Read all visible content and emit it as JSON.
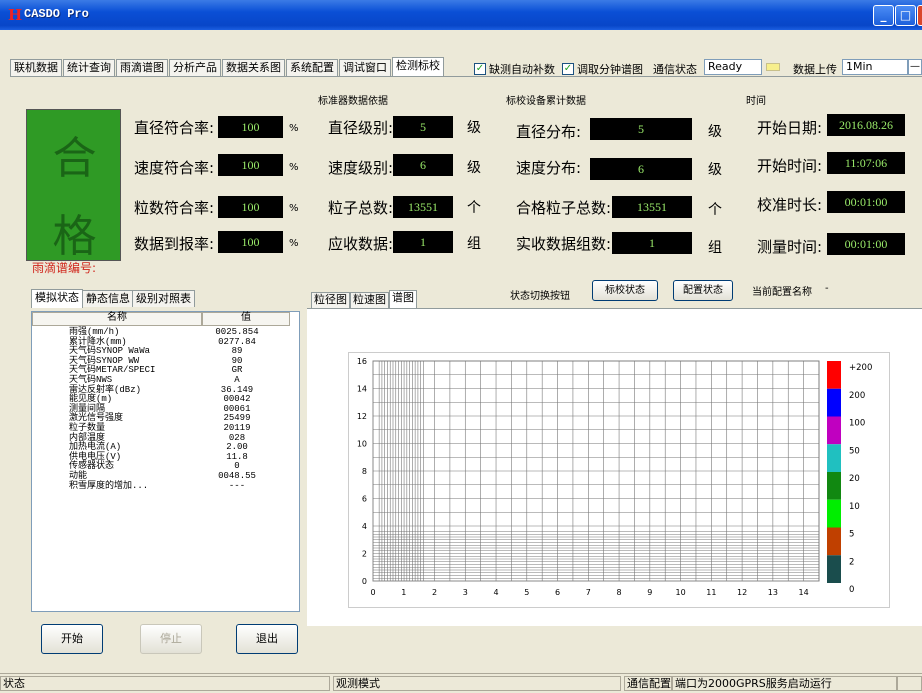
{
  "window": {
    "title": "CASDO Pro",
    "icon": "app-logo-icon"
  },
  "main_tabs": [
    "联机数据",
    "统计查询",
    "雨滴谱图",
    "分析产品",
    "数据关系图",
    "系统配置",
    "调试窗口",
    "检测标校"
  ],
  "active_tab": "检测标校",
  "toolbar": {
    "auto_fill_label": "缺测自动补数",
    "auto_fill_checked": true,
    "fetch_min_label": "调取分钟谱图",
    "fetch_min_checked": true,
    "comm_status_label": "通信状态",
    "comm_status_value": "Ready",
    "upload_label": "数据上传",
    "upload_value": "1Min"
  },
  "result": {
    "chars": [
      "合",
      "格"
    ],
    "color": "#2f9a25"
  },
  "rates": [
    {
      "label": "直径符合率:",
      "value": "100",
      "unit": "%"
    },
    {
      "label": "速度符合率:",
      "value": "100",
      "unit": "%"
    },
    {
      "label": "粒数符合率:",
      "value": "100",
      "unit": "%"
    },
    {
      "label": "数据到报率:",
      "value": "100",
      "unit": "%"
    }
  ],
  "standard_section": {
    "title": "标准器数据依据",
    "rows": [
      {
        "label": "直径级别:",
        "value": "5",
        "unit": "级"
      },
      {
        "label": "速度级别:",
        "value": "6",
        "unit": "级"
      },
      {
        "label": "粒子总数:",
        "value": "13551",
        "unit": "个"
      },
      {
        "label": "应收数据:",
        "value": "1",
        "unit": "组"
      }
    ]
  },
  "calib_section": {
    "title": "标校设备累计数据",
    "rows": [
      {
        "label": "直径分布:",
        "value": "5",
        "unit": "级"
      },
      {
        "label": "速度分布:",
        "value": "6",
        "unit": "级"
      },
      {
        "label": "合格粒子总数:",
        "value": "13551",
        "unit": "个"
      },
      {
        "label": "实收数据组数:",
        "value": "1",
        "unit": "组"
      }
    ]
  },
  "time_section": {
    "title": "时间",
    "rows": [
      {
        "label": "开始日期:",
        "value": "2016.08.26"
      },
      {
        "label": "开始时间:",
        "value": "11:07:06"
      },
      {
        "label": "校准时长:",
        "value": "00:01:00"
      },
      {
        "label": "测量时间:",
        "value": "00:01:00"
      }
    ]
  },
  "raindrop_id_label": "雨滴谱编号:",
  "left_tabs": [
    "模拟状态",
    "静态信息",
    "级别对照表"
  ],
  "list": {
    "headers": [
      "名称",
      "值"
    ],
    "rows": [
      [
        "雨强(mm/h)",
        "0025.854"
      ],
      [
        "累计降水(mm)",
        "0277.84"
      ],
      [
        "天气码SYNOP WaWa",
        "89"
      ],
      [
        "天气码SYNOP WW",
        "90"
      ],
      [
        "天气码METAR/SPECI",
        "GR"
      ],
      [
        "天气码NWS",
        "A"
      ],
      [
        "雷达反射率(dBz)",
        "36.149"
      ],
      [
        "能见度(m)",
        "00042"
      ],
      [
        "测量间隔",
        "00061"
      ],
      [
        "激光信号强度",
        "25499"
      ],
      [
        "粒子数量",
        "20119"
      ],
      [
        "内部温度",
        "028"
      ],
      [
        "加热电流(A)",
        "2.00"
      ],
      [
        "供电电压(V)",
        "11.8"
      ],
      [
        "传感器状态",
        "0"
      ],
      [
        "动能",
        "0048.55"
      ],
      [
        "积雪厚度的增加...",
        "---"
      ]
    ]
  },
  "buttons": {
    "start": "开始",
    "stop": "停止",
    "exit": "退出"
  },
  "chart_tabs": [
    "粒径图",
    "粒速图",
    "谱图"
  ],
  "state_switch": {
    "label": "状态切换按钮",
    "calib_btn": "标校状态",
    "config_btn": "配置状态",
    "current_config_label": "当前配置名称",
    "current_config_value": "-"
  },
  "chart_data": {
    "type": "heatmap",
    "title": "",
    "xlabel": "",
    "ylabel": "",
    "x_ticks": [
      "0",
      "1",
      "2",
      "3",
      "4",
      "5",
      "6",
      "7",
      "8",
      "9",
      "10",
      "11",
      "12",
      "13",
      "14"
    ],
    "y_ticks": [
      "0",
      "2",
      "4",
      "6",
      "8",
      "10",
      "12",
      "14",
      "16"
    ],
    "xlim": [
      0,
      14.5
    ],
    "ylim": [
      0,
      16
    ],
    "grid": true,
    "cells": [],
    "colorbar": [
      {
        "label": "+200",
        "color": "#ff0000"
      },
      {
        "label": "200",
        "color": "#0000ff"
      },
      {
        "label": "100",
        "color": "#c000c0"
      },
      {
        "label": "50",
        "color": "#20c0c0"
      },
      {
        "label": "20",
        "color": "#118811"
      },
      {
        "label": "10",
        "color": "#00ee00"
      },
      {
        "label": "5",
        "color": "#c04000"
      },
      {
        "label": "2",
        "color": "#1a4d4d"
      },
      {
        "label": "0",
        "color": ""
      }
    ]
  },
  "statusbar": {
    "status_label": "状态",
    "mode": "观测模式",
    "comm_config": "通信配置",
    "port_message": "端口为2000GPRS服务启动运行"
  }
}
